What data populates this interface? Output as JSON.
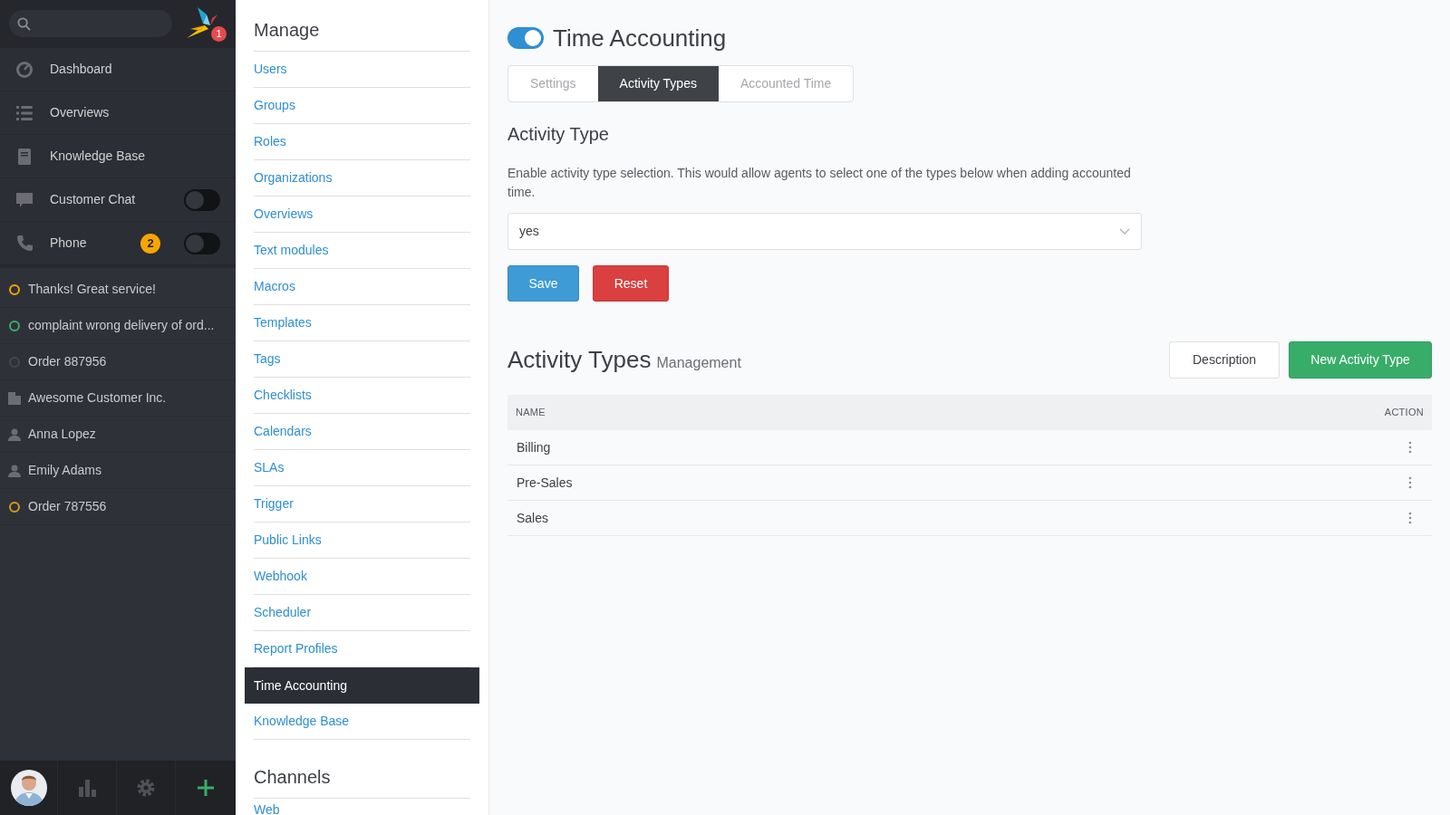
{
  "sidebar": {
    "notification_count": "1",
    "nav": [
      {
        "kind": "link",
        "label": "Dashboard"
      },
      {
        "kind": "link",
        "label": "Overviews"
      },
      {
        "kind": "link",
        "label": "Knowledge Base"
      },
      {
        "kind": "toggle",
        "label": "Customer Chat",
        "on": false
      },
      {
        "kind": "toggle",
        "label": "Phone",
        "on": false,
        "badge": "2"
      }
    ],
    "recent": [
      {
        "kind": "ticket",
        "label": "Thanks! Great service!",
        "color": "#f7a600"
      },
      {
        "kind": "ticket",
        "label": "complaint wrong delivery of ord...",
        "color": "#38ad69"
      },
      {
        "kind": "ticket",
        "label": "Order 887956",
        "color": "#44464d"
      },
      {
        "kind": "organization",
        "label": "Awesome Customer Inc."
      },
      {
        "kind": "user",
        "label": "Anna Lopez"
      },
      {
        "kind": "user",
        "label": "Emily Adams"
      },
      {
        "kind": "ticket",
        "label": "Order 787556",
        "color": "#d19c1d"
      }
    ]
  },
  "manage": {
    "title": "Manage",
    "items": [
      {
        "label": "Users",
        "selected": false
      },
      {
        "label": "Groups",
        "selected": false
      },
      {
        "label": "Roles",
        "selected": false
      },
      {
        "label": "Organizations",
        "selected": false
      },
      {
        "label": "Overviews",
        "selected": false
      },
      {
        "label": "Text modules",
        "selected": false
      },
      {
        "label": "Macros",
        "selected": false
      },
      {
        "label": "Templates",
        "selected": false
      },
      {
        "label": "Tags",
        "selected": false
      },
      {
        "label": "Checklists",
        "selected": false
      },
      {
        "label": "Calendars",
        "selected": false
      },
      {
        "label": "SLAs",
        "selected": false
      },
      {
        "label": "Trigger",
        "selected": false
      },
      {
        "label": "Public Links",
        "selected": false
      },
      {
        "label": "Webhook",
        "selected": false
      },
      {
        "label": "Scheduler",
        "selected": false
      },
      {
        "label": "Report Profiles",
        "selected": false
      },
      {
        "label": "Time Accounting",
        "selected": true
      },
      {
        "label": "Knowledge Base",
        "selected": false
      }
    ],
    "channels_title": "Channels",
    "channels": [
      {
        "label": "Web",
        "selected": false
      }
    ]
  },
  "main": {
    "enabled": true,
    "title": "Time Accounting",
    "tabs": [
      {
        "label": "Settings",
        "selected": false
      },
      {
        "label": "Activity Types",
        "selected": true
      },
      {
        "label": "Accounted Time",
        "selected": false
      }
    ],
    "section_title": "Activity Type",
    "description": "Enable activity type selection. This would allow agents to select one of the types below when adding accounted time.",
    "select_value": "yes",
    "save": "Save",
    "reset": "Reset",
    "list_title": "Activity Types",
    "list_subtitle": "Management",
    "buttons": [
      "Description",
      "New Activity Type"
    ],
    "table": {
      "columns": [
        "NAME",
        "ACTION"
      ],
      "rows": [
        "Billing",
        "Pre-Sales",
        "Sales"
      ]
    }
  }
}
